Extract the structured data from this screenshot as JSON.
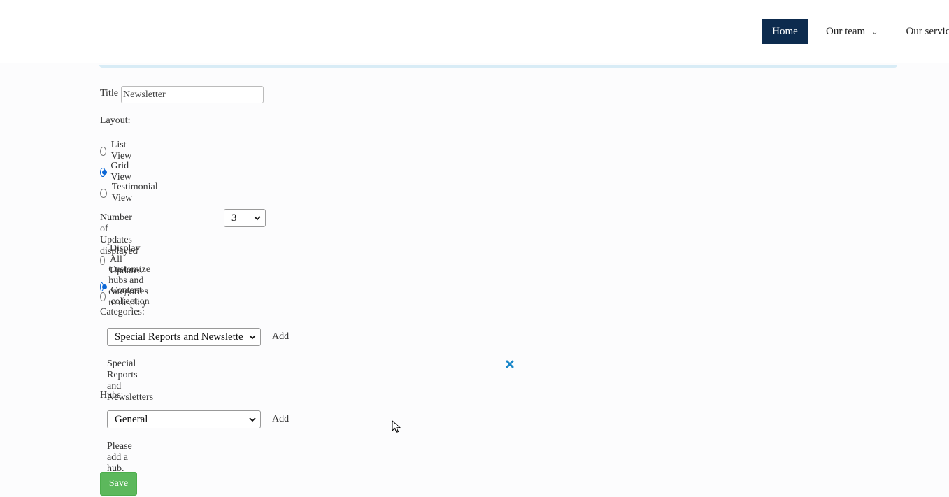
{
  "nav": {
    "home": "Home",
    "our_team": "Our team",
    "our_services": "Our servic"
  },
  "form": {
    "title_label": "Title",
    "title_value": "Newsletter",
    "layout_label": "Layout:",
    "layout_options": [
      "List View",
      "Grid View",
      "Testimonial View"
    ],
    "layout_selected": "Grid View",
    "updates_label": "Number of Updates displayed",
    "updates_value": "3",
    "display_options": [
      "Display All Updates",
      "Customize hubs and categories to display",
      "Content collection"
    ],
    "display_selected": "Customize hubs and categories to display",
    "categories_label": "Categories:",
    "category_select_value": "Special Reports and Newsletters",
    "category_add": "Add",
    "category_items": [
      "Special Reports and Newsletters"
    ],
    "hubs_label": "Hubs:",
    "hub_select_value": "General",
    "hub_add": "Add",
    "hub_empty": "Please add a hub.",
    "save": "Save"
  },
  "colors": {
    "nav_active": "#0d2b4e",
    "save": "#5cb85c",
    "radio": "#0a66d6",
    "remove_icon": "#1a87c9"
  },
  "icons": {
    "dropdown": "chevron-down-icon",
    "remove": "close-icon",
    "cursor": "mouse-pointer-icon"
  }
}
